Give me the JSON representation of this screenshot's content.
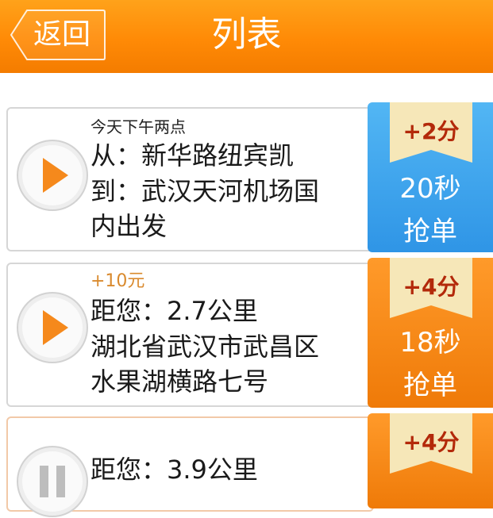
{
  "header": {
    "title": "列表",
    "back_label": "返回",
    "background": "#ff8a06"
  },
  "orders": [
    {
      "time": "今天下午两点",
      "from": "从：新华路纽宾凯",
      "to_line1": "到：武汉天河机场国",
      "to_line2": "内出发",
      "points": "+2分",
      "countdown": "20秒",
      "action_label": "抢单",
      "action_color": "#3aa3ee"
    },
    {
      "bonus": "+10元",
      "distance": "距您：2.7公里",
      "addr_line1": "湖北省武汉市武昌区",
      "addr_line2": "水果湖横路七号",
      "points": "+4分",
      "countdown": "18秒",
      "action_label": "抢单",
      "action_color": "#f7890f"
    },
    {
      "distance": "距您：3.9公里",
      "points": "+4分",
      "action_color": "#f7890f"
    }
  ],
  "icons": {
    "play": "play-icon",
    "back": "back-arrow-icon",
    "ribbon": "points-ribbon"
  }
}
